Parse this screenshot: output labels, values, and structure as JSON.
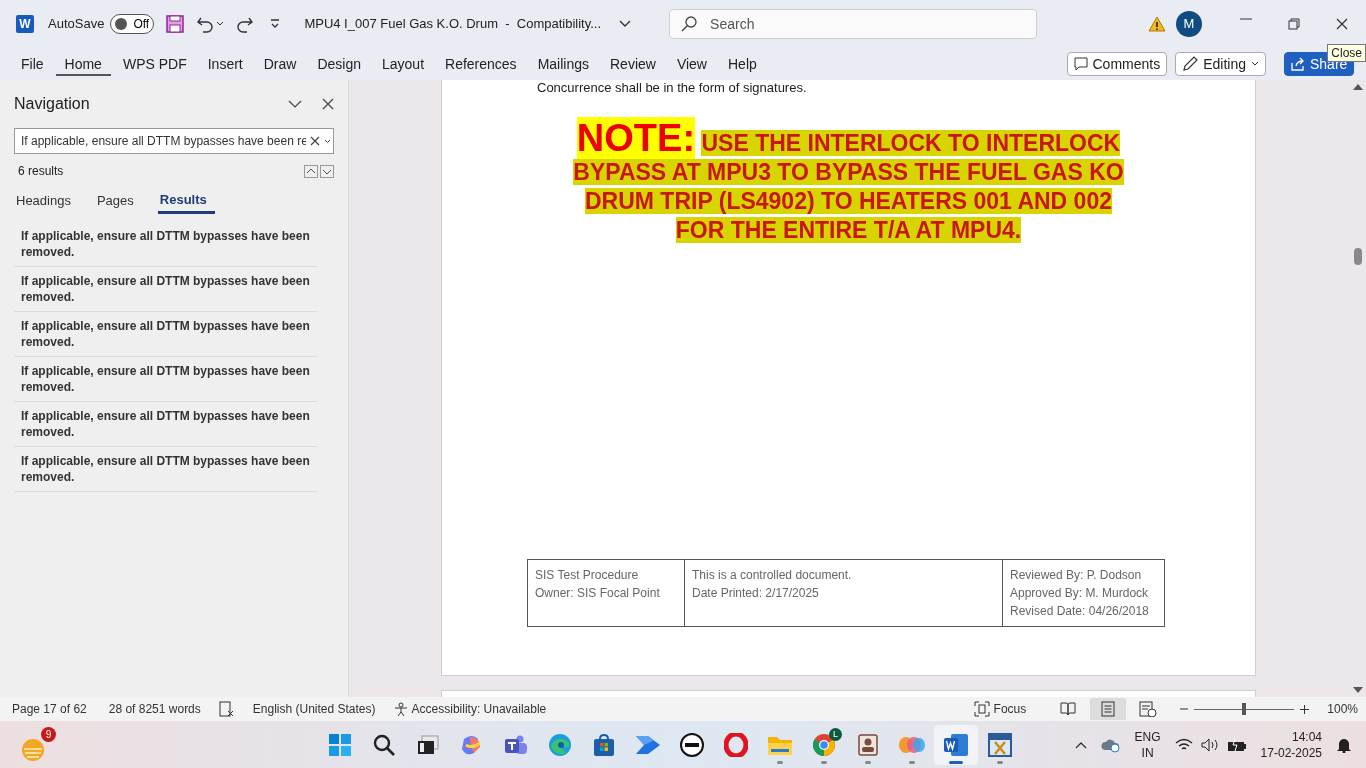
{
  "title_bar": {
    "app_letter": "W",
    "autosave": {
      "label": "AutoSave",
      "on": false,
      "state_label": "Off"
    },
    "document_title": "MPU4 I_007 Fuel Gas K.O. Drum  -  Compatibility...",
    "search": {
      "placeholder": "Search"
    },
    "avatar": "M"
  },
  "tooltip": "Close",
  "ribbon": {
    "tabs": [
      {
        "label": "File",
        "selected": false
      },
      {
        "label": "Home",
        "selected": true
      },
      {
        "label": "WPS PDF",
        "selected": false
      },
      {
        "label": "Insert",
        "selected": false
      },
      {
        "label": "Draw",
        "selected": false
      },
      {
        "label": "Design",
        "selected": false
      },
      {
        "label": "Layout",
        "selected": false
      },
      {
        "label": "References",
        "selected": false
      },
      {
        "label": "Mailings",
        "selected": false
      },
      {
        "label": "Review",
        "selected": false
      },
      {
        "label": "View",
        "selected": false
      },
      {
        "label": "Help",
        "selected": false
      }
    ],
    "comments": "Comments",
    "editing": "Editing",
    "share": "Share"
  },
  "navigation": {
    "title": "Navigation",
    "search_value": "If applicable, ensure all DTTM bypasses have been re",
    "result_count": "6 results",
    "tabs": [
      {
        "label": "Headings",
        "selected": false
      },
      {
        "label": "Pages",
        "selected": false
      },
      {
        "label": "Results",
        "selected": true
      }
    ],
    "results": [
      "If applicable, ensure all DTTM bypasses have been removed.",
      "If applicable, ensure all DTTM bypasses have been removed.",
      "If applicable, ensure all DTTM bypasses have been removed.",
      "If applicable, ensure all DTTM bypasses have been removed.",
      "If applicable, ensure all DTTM bypasses have been removed.",
      "If applicable, ensure all DTTM bypasses have been removed."
    ]
  },
  "document": {
    "cut_line": "Concurrence shall be in the form of signatures.",
    "note_label": "NOTE:",
    "note_text": "USE THE INTERLOCK TO INTERLOCK BYPASS AT MPU3 TO BYPASS THE FUEL GAS KO DRUM TRIP (LS4902) TO HEATERS 001 AND 002 FOR THE ENTIRE T/A AT MPU4.",
    "footer": [
      [
        "SIS Test Procedure",
        "Owner: SIS Focal Point"
      ],
      [
        "This is a controlled document.",
        "Date Printed: 2/17/2025"
      ],
      [
        "Reviewed By: P. Dodson",
        "Approved By: M. Murdock",
        "Revised Date: 04/26/2018"
      ]
    ]
  },
  "status_bar": {
    "page": "Page 17 of 62",
    "words": "28 of 8251 words",
    "language": "English (United States)",
    "accessibility": "Accessibility: Unavailable",
    "focus": "Focus",
    "views": [
      {
        "kind": "read",
        "selected": false
      },
      {
        "kind": "print",
        "selected": true
      },
      {
        "kind": "web",
        "selected": false
      }
    ],
    "zoom": {
      "level": 0.5,
      "reading": "100%"
    }
  },
  "taskbar": {
    "widget_badge": "9",
    "apps": [
      {
        "kind": "start",
        "running": false,
        "selected": false
      },
      {
        "kind": "search",
        "running": false,
        "selected": false
      },
      {
        "kind": "taskview",
        "running": false,
        "selected": false
      },
      {
        "kind": "copilot",
        "running": false,
        "selected": false
      },
      {
        "kind": "teams",
        "running": false,
        "selected": false
      },
      {
        "kind": "edge",
        "running": false,
        "selected": false
      },
      {
        "kind": "store",
        "running": false,
        "selected": false
      },
      {
        "kind": "automate",
        "running": false,
        "selected": false
      },
      {
        "kind": "dell",
        "running": false,
        "selected": false
      },
      {
        "kind": "opera",
        "running": false,
        "selected": false
      },
      {
        "kind": "folder",
        "running": true,
        "selected": false
      },
      {
        "kind": "chrome",
        "running": true,
        "selected": false,
        "badge": "L"
      },
      {
        "kind": "contact",
        "running": true,
        "selected": false
      },
      {
        "kind": "blobs",
        "running": true,
        "selected": false
      },
      {
        "kind": "word",
        "running": true,
        "selected": true
      },
      {
        "kind": "snip",
        "running": true,
        "selected": false
      }
    ],
    "language": [
      "ENG",
      "IN"
    ],
    "time": "14:04",
    "date": "17-02-2025"
  }
}
